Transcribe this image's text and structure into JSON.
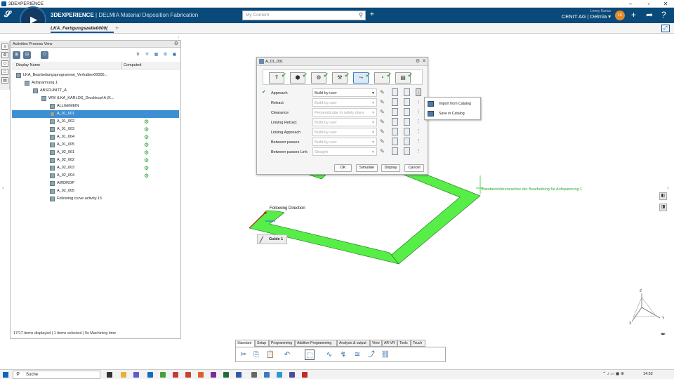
{
  "window": {
    "title": "3DEXPERIENCE"
  },
  "topbar": {
    "brand_bold": "3DEXPERIENCE",
    "brand_sep": " | DELMIA ",
    "brand_app": "Material Deposition Fabrication",
    "search_placeholder": "My Content",
    "compass_version": "V,R",
    "user_name": "Lenny Karius",
    "company": "CENIT AG | Delmia ▾",
    "avatar_initials": "LK"
  },
  "tab": {
    "doc_title": "LKA_Fertigungszelle0000(",
    "add": "+"
  },
  "panel": {
    "title": "Activities Process View",
    "col_display": "Display Name",
    "col_computed": "Computed",
    "rows": [
      {
        "label": "LKA_Bearbeitungsprogramme_Verhalten00000...",
        "indent": 6,
        "computed": false,
        "selected": false
      },
      {
        "label": "Aufspannung.1",
        "indent": 18,
        "computed": false,
        "selected": false
      },
      {
        "label": "ABSCHNITT_A",
        "indent": 30,
        "computed": false,
        "selected": false
      },
      {
        "label": "WW (LKA_KARLOS_Druckkopf A (K...",
        "indent": 42,
        "computed": false,
        "selected": false
      },
      {
        "label": "ALLGEMEIN",
        "indent": 54,
        "computed": false,
        "selected": false
      },
      {
        "label": "A_01_001",
        "indent": 54,
        "computed": false,
        "selected": true
      },
      {
        "label": "A_01_002",
        "indent": 54,
        "computed": true,
        "selected": false
      },
      {
        "label": "A_01_003",
        "indent": 54,
        "computed": true,
        "selected": false
      },
      {
        "label": "A_01_004",
        "indent": 54,
        "computed": true,
        "selected": false
      },
      {
        "label": "A_01_005",
        "indent": 54,
        "computed": true,
        "selected": false
      },
      {
        "label": "A_02_001",
        "indent": 54,
        "computed": true,
        "selected": false
      },
      {
        "label": "A_02_002",
        "indent": 54,
        "computed": true,
        "selected": false
      },
      {
        "label": "A_02_003",
        "indent": 54,
        "computed": true,
        "selected": false
      },
      {
        "label": "A_02_004",
        "indent": 54,
        "computed": true,
        "selected": false
      },
      {
        "label": "AIRDROP",
        "indent": 54,
        "computed": false,
        "selected": false
      },
      {
        "label": "A_02_005",
        "indent": 54,
        "computed": false,
        "selected": false
      },
      {
        "label": "Following curve activity.13",
        "indent": 54,
        "computed": false,
        "selected": false
      }
    ],
    "status": "17/17 items displayed | 1 items selected | 0s Machining time"
  },
  "dialog": {
    "title": "A_01_001",
    "rows": [
      {
        "label": "Approach",
        "value": "Build by user",
        "done": true,
        "enabled": true
      },
      {
        "label": "Retract",
        "value": "Build by user",
        "done": false,
        "enabled": false
      },
      {
        "label": "Clearance",
        "value": "Perpendicular to safety plane",
        "done": false,
        "enabled": false
      },
      {
        "label": "Linking Retract",
        "value": "Build by user",
        "done": false,
        "enabled": false
      },
      {
        "label": "Linking Approach",
        "value": "Build by user",
        "done": false,
        "enabled": false
      },
      {
        "label": "Between passes",
        "value": "Build by user",
        "done": false,
        "enabled": false
      },
      {
        "label": "Between passes Link",
        "value": "Straight",
        "done": false,
        "enabled": false
      }
    ],
    "buttons": {
      "ok": "OK",
      "simulate": "Simulate",
      "display": "Display",
      "cancel": "Cancel"
    }
  },
  "context_menu": {
    "import": "Import from Catalog",
    "save": "Save in Catalog"
  },
  "viewport": {
    "axis_label": "Standardreferenzachse der Bearbeitung für Aufspannung.1",
    "direction_label": "Following Direction",
    "guide_label": "Guide 1",
    "triad": {
      "x": "X",
      "y": "Y",
      "z": "Z"
    }
  },
  "bottom_tabs": [
    "Standard",
    "Setup",
    "Programming",
    "Additive Programming",
    "Analysis & output",
    "View",
    "AR-VR",
    "Tools",
    "Touch"
  ],
  "taskbar": {
    "search": "Suche",
    "time": "14:52"
  },
  "colors": {
    "brand": "#0a4a7a",
    "part": "#56ee47",
    "check": "#2c9c2c",
    "selection": "#3d8fd4"
  }
}
